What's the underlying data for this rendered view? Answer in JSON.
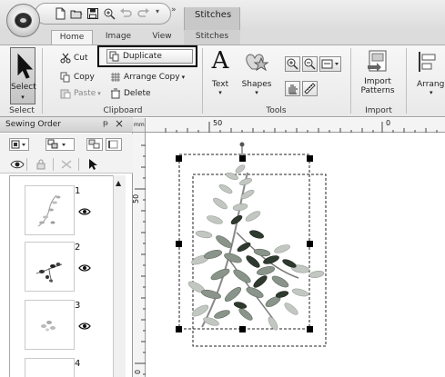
{
  "app": {
    "context_tab_title": "Stitches"
  },
  "tabs": [
    {
      "label": "Home",
      "active": true
    },
    {
      "label": "Image",
      "active": false
    },
    {
      "label": "View",
      "active": false
    },
    {
      "label": "Stitches",
      "active": false
    }
  ],
  "ribbon": {
    "select": {
      "label": "Select"
    },
    "clipboard": {
      "cut": "Cut",
      "copy": "Copy",
      "paste": "Paste",
      "duplicate": "Duplicate",
      "arrange_copy": "Arrange Copy",
      "delete": "Delete"
    },
    "tools": {
      "text": "Text",
      "shapes": "Shapes"
    },
    "import": {
      "line1": "Import",
      "line2": "Patterns"
    },
    "arrange": {
      "label": "Arrang"
    },
    "group_labels": {
      "select": "Select",
      "clipboard": "Clipboard",
      "tools": "Tools",
      "import": "Import"
    }
  },
  "sewing_order": {
    "title": "Sewing Order",
    "pin": "ᵽ",
    "close": "×",
    "items": [
      {
        "number": "1"
      },
      {
        "number": "2"
      },
      {
        "number": "3"
      },
      {
        "number": "4"
      }
    ]
  },
  "rulers": {
    "top": [
      "50",
      "0"
    ],
    "left": [
      "50",
      "0"
    ],
    "corner_unit": "mm"
  },
  "colors": {
    "accent_selection": "#000000",
    "ribbon_bg": "#efefef",
    "leaf_dark": "#2f3a2f",
    "leaf_mid": "#6a766a",
    "leaf_light": "#b9c0b9"
  }
}
